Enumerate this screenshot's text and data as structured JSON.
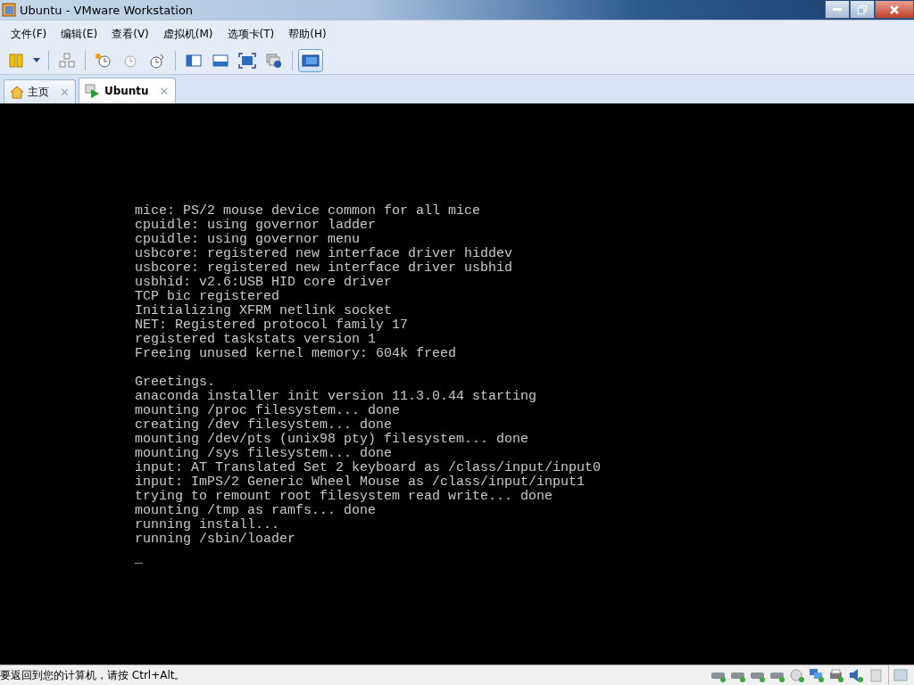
{
  "window": {
    "title": "Ubuntu - VMware Workstation"
  },
  "menu": [
    "文件(F)",
    "编辑(E)",
    "查看(V)",
    "虚拟机(M)",
    "选项卡(T)",
    "帮助(H)"
  ],
  "toolbar_groups": [
    [
      {
        "kind": "power",
        "pressed": false
      },
      {
        "kind": "dropdown",
        "pressed": false
      }
    ],
    [
      {
        "kind": "network",
        "pressed": false
      }
    ],
    [
      {
        "kind": "snapshot",
        "pressed": false
      },
      {
        "kind": "revert",
        "pressed": false
      },
      {
        "kind": "manage",
        "pressed": false
      }
    ],
    [
      {
        "kind": "sidebar",
        "pressed": false
      },
      {
        "kind": "thumbs",
        "pressed": false
      },
      {
        "kind": "fullscreen",
        "pressed": false
      },
      {
        "kind": "unity",
        "pressed": false
      }
    ],
    [
      {
        "kind": "console",
        "pressed": true
      }
    ]
  ],
  "tabs": [
    {
      "kind": "home",
      "label": "主页",
      "close": "✕",
      "selected": false
    },
    {
      "kind": "vm",
      "label": "Ubuntu",
      "close": "✕",
      "selected": true
    }
  ],
  "console": {
    "paragraphs": [
      [
        "mice: PS/2 mouse device common for all mice",
        "cpuidle: using governor ladder",
        "cpuidle: using governor menu",
        "usbcore: registered new interface driver hiddev",
        "usbcore: registered new interface driver usbhid",
        "usbhid: v2.6:USB HID core driver",
        "TCP bic registered",
        "Initializing XFRM netlink socket",
        "NET: Registered protocol family 17",
        "registered taskstats version 1",
        "Freeing unused kernel memory: 604k freed"
      ],
      [
        "Greetings.",
        "anaconda installer init version 11.3.0.44 starting",
        "mounting /proc filesystem... done",
        "creating /dev filesystem... done",
        "mounting /dev/pts (unix98 pty) filesystem... done",
        "mounting /sys filesystem... done",
        "input: AT Translated Set 2 keyboard as /class/input/input0",
        "input: ImPS/2 Generic Wheel Mouse as /class/input/input1",
        "trying to remount root filesystem read write... done",
        "mounting /tmp as ramfs... done",
        "running install...",
        "running /sbin/loader"
      ]
    ],
    "cursor": "_"
  },
  "status_bar": {
    "message": "要返回到您的计算机，请按 Ctrl+Alt。",
    "devices": [
      {
        "kind": "disk"
      },
      {
        "kind": "disk"
      },
      {
        "kind": "disk"
      },
      {
        "kind": "disk"
      },
      {
        "kind": "cd"
      },
      {
        "kind": "network"
      },
      {
        "kind": "printer"
      },
      {
        "kind": "sound"
      },
      {
        "kind": "usb"
      }
    ]
  }
}
